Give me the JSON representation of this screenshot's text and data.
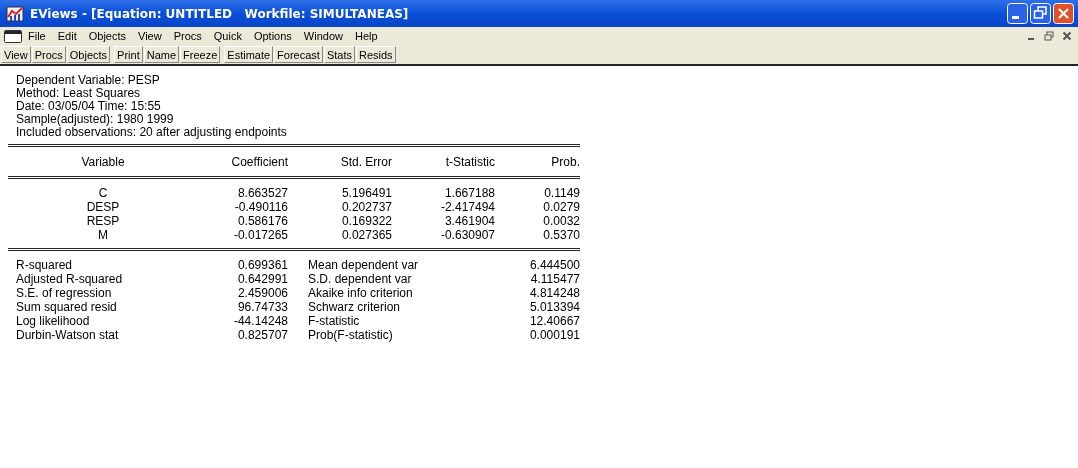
{
  "window": {
    "title": "EViews - [Equation: UNTITLED   Workfile: SIMULTANEAS]"
  },
  "menu_bar": {
    "items": [
      "File",
      "Edit",
      "Objects",
      "View",
      "Procs",
      "Quick",
      "Options",
      "Window",
      "Help"
    ]
  },
  "toolbar": {
    "groups": [
      [
        "View",
        "Procs",
        "Objects"
      ],
      [
        "Print",
        "Name",
        "Freeze"
      ],
      [
        "Estimate",
        "Forecast",
        "Stats",
        "Resids"
      ]
    ]
  },
  "output": {
    "header_lines": [
      "Dependent Variable: PESP",
      "Method: Least Squares",
      "Date: 03/05/04   Time: 15:55",
      "Sample(adjusted): 1980 1999",
      "Included observations: 20 after adjusting endpoints"
    ],
    "columns": [
      "Variable",
      "Coefficient",
      "Std. Error",
      "t-Statistic",
      "Prob."
    ],
    "rows": [
      [
        "C",
        "8.663527",
        "5.196491",
        "1.667188",
        "0.1149"
      ],
      [
        "DESP",
        "-0.490116",
        "0.202737",
        "-2.417494",
        "0.0279"
      ],
      [
        "RESP",
        "0.586176",
        "0.169322",
        "3.461904",
        "0.0032"
      ],
      [
        "M",
        "-0.017265",
        "0.027365",
        "-0.630907",
        "0.5370"
      ]
    ],
    "statistics": [
      [
        "R-squared",
        "0.699361",
        "Mean dependent var",
        "6.444500"
      ],
      [
        "Adjusted R-squared",
        "0.642991",
        "S.D. dependent var",
        "4.115477"
      ],
      [
        "S.E. of regression",
        "2.459006",
        "Akaike info criterion",
        "4.814248"
      ],
      [
        "Sum squared resid",
        "96.74733",
        "Schwarz criterion",
        "5.013394"
      ],
      [
        "Log likelihood",
        "-44.14248",
        "F-statistic",
        "12.40667"
      ],
      [
        "Durbin-Watson stat",
        "0.825707",
        "Prob(F-statistic)",
        "0.000191"
      ]
    ]
  }
}
